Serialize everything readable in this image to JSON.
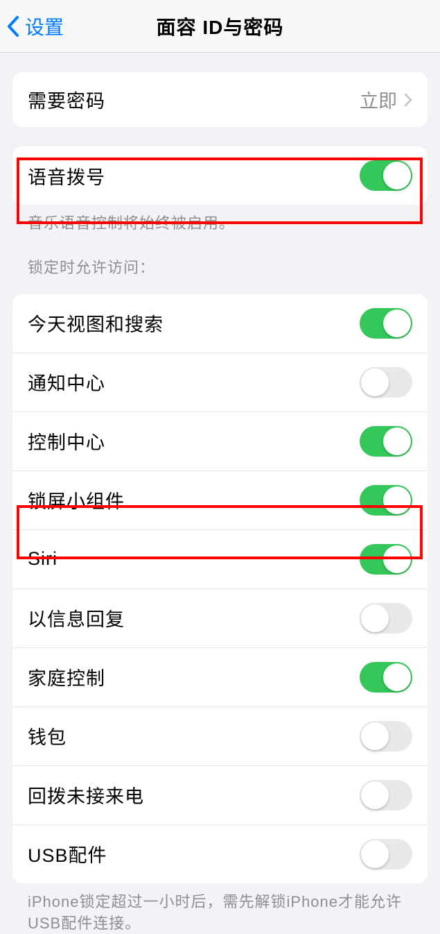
{
  "header": {
    "back_label": "设置",
    "title": "面容 ID与密码"
  },
  "require_passcode": {
    "label": "需要密码",
    "value": "立即"
  },
  "voice_dial": {
    "label": "语音拨号",
    "enabled": true,
    "footer": "音乐语音控制将始终被启用。"
  },
  "locked_access": {
    "header": "锁定时允许访问：",
    "items": [
      {
        "label": "今天视图和搜索",
        "enabled": true
      },
      {
        "label": "通知中心",
        "enabled": false
      },
      {
        "label": "控制中心",
        "enabled": true
      },
      {
        "label": "锁屏小组件",
        "enabled": true
      },
      {
        "label": "Siri",
        "enabled": true
      },
      {
        "label": "以信息回复",
        "enabled": false
      },
      {
        "label": "家庭控制",
        "enabled": true
      },
      {
        "label": "钱包",
        "enabled": false
      },
      {
        "label": "回拨未接来电",
        "enabled": false
      },
      {
        "label": "USB配件",
        "enabled": false
      }
    ],
    "footer": "iPhone锁定超过一小时后，需先解锁iPhone才能允许USB配件连接。"
  }
}
